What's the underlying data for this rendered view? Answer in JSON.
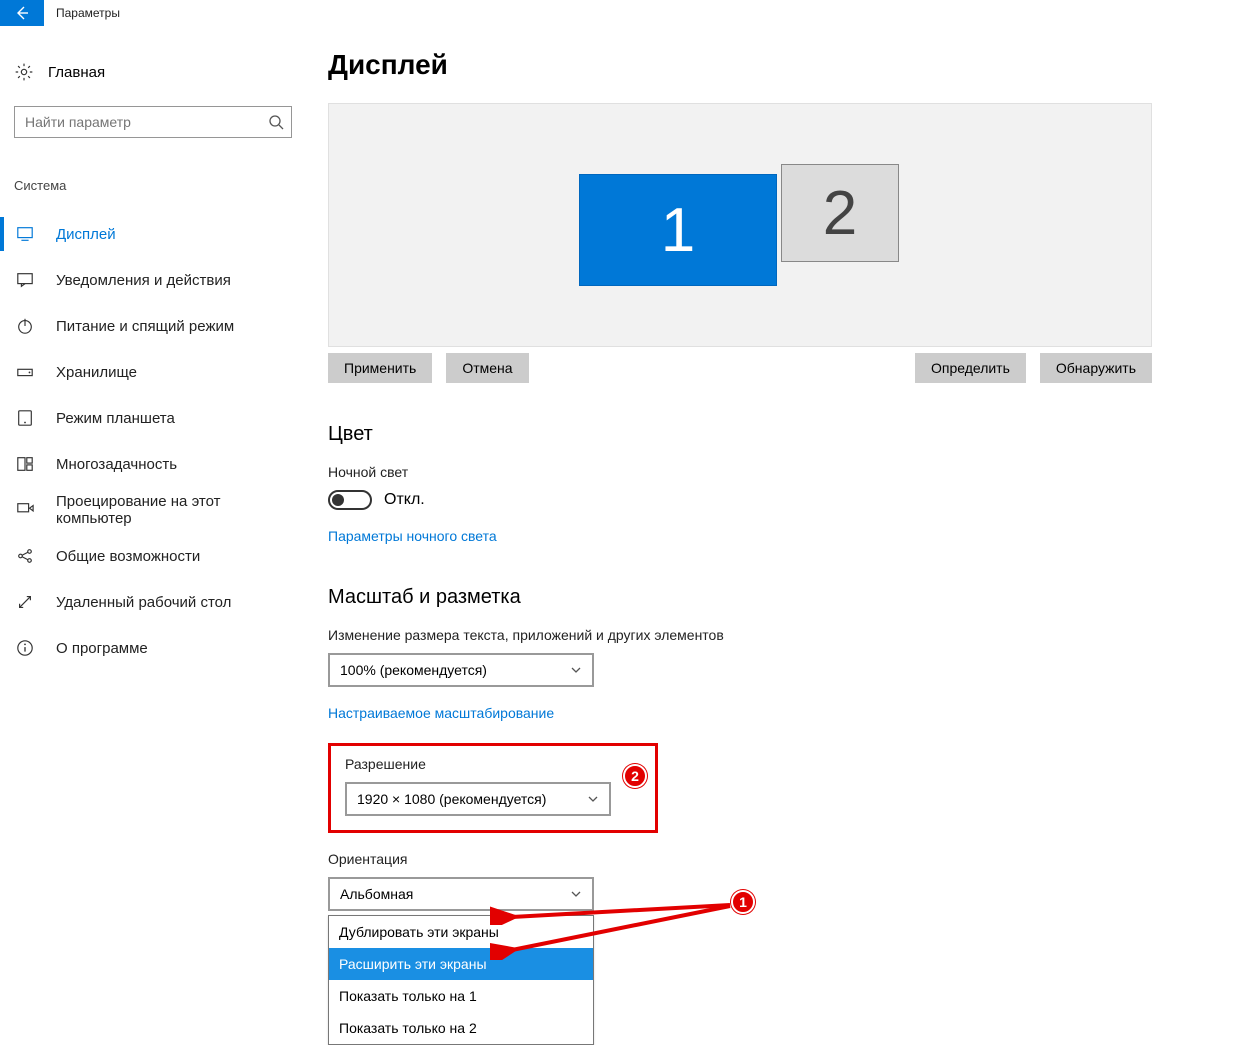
{
  "titlebar": {
    "text": "Параметры"
  },
  "sidebar": {
    "home": "Главная",
    "search_placeholder": "Найти параметр",
    "category": "Система",
    "items": [
      {
        "label": "Дисплей"
      },
      {
        "label": "Уведомления и действия"
      },
      {
        "label": "Питание и спящий режим"
      },
      {
        "label": "Хранилище"
      },
      {
        "label": "Режим планшета"
      },
      {
        "label": "Многозадачность"
      },
      {
        "label": "Проецирование на этот компьютер"
      },
      {
        "label": "Общие возможности"
      },
      {
        "label": "Удаленный рабочий стол"
      },
      {
        "label": "О программе"
      }
    ]
  },
  "main": {
    "title": "Дисплей",
    "monitors": {
      "primary": "1",
      "secondary": "2"
    },
    "buttons": {
      "apply": "Применить",
      "cancel": "Отмена",
      "identify": "Определить",
      "detect": "Обнаружить"
    },
    "color": {
      "heading": "Цвет",
      "night_label": "Ночной свет",
      "toggle_state": "Откл.",
      "settings_link": "Параметры ночного света"
    },
    "scale": {
      "heading": "Масштаб и разметка",
      "size_label": "Изменение размера текста, приложений и других элементов",
      "size_value": "100% (рекомендуется)",
      "custom_link": "Настраиваемое масштабирование",
      "resolution_label": "Разрешение",
      "resolution_value": "1920 × 1080 (рекомендуется)",
      "orientation_label": "Ориентация",
      "orientation_value": "Альбомная"
    },
    "multi_dropdown": {
      "opt0": "Дублировать эти экраны",
      "opt1": "Расширить эти экраны",
      "opt2": "Показать только на 1",
      "opt3": "Показать только на 2"
    },
    "annotations": {
      "c1": "1",
      "c2": "2"
    }
  }
}
